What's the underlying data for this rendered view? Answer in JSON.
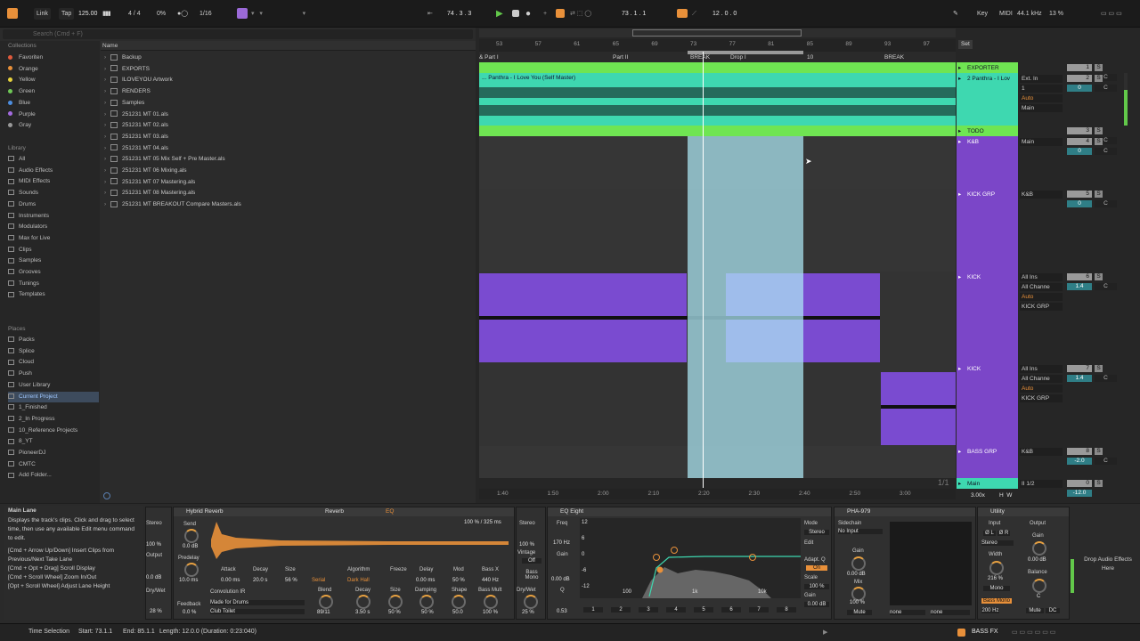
{
  "transport": {
    "link": "Link",
    "tap": "Tap",
    "tempo": "125.00",
    "meter": "4 / 4",
    "percent": "0%",
    "quantize": "1/16",
    "position": "74 . 3 . 3",
    "loop_start": "73 . 1 . 1",
    "loop_length": "12 . 0 . 0",
    "key": "Key",
    "midi": "MIDI",
    "sample_rate": "44.1 kHz",
    "cpu": "13 %"
  },
  "browser": {
    "search_placeholder": "Search (Cmd + F)",
    "collections_heading": "Collections",
    "collections": [
      {
        "label": "Favoriten",
        "color": "#e05a3c"
      },
      {
        "label": "Orange",
        "color": "#e8903a"
      },
      {
        "label": "Yellow",
        "color": "#e7d23d"
      },
      {
        "label": "Green",
        "color": "#6fc857"
      },
      {
        "label": "Blue",
        "color": "#4d8ee0"
      },
      {
        "label": "Purple",
        "color": "#a46be0"
      },
      {
        "label": "Gray",
        "color": "#999999"
      }
    ],
    "library_heading": "Library",
    "library": [
      "All",
      "Audio Effects",
      "MIDI Effects",
      "Sounds",
      "Drums",
      "Instruments",
      "Modulators",
      "Max for Live",
      "Clips",
      "Samples",
      "Grooves",
      "Tunings",
      "Templates"
    ],
    "places_heading": "Places",
    "places": [
      "Packs",
      "Splice",
      "Cloud",
      "Push",
      "User Library",
      "Current Project",
      "1_Finished",
      "2_In Progress",
      "10_Reference Projects",
      "8_YT",
      "PioneerDJ",
      "CMTC",
      "Add Folder..."
    ],
    "name_header": "Name",
    "files": [
      "Backup",
      "EXPORTS",
      "ILOVEYOU Artwork",
      "RENDERS",
      "Samples",
      "251231 MT 01.als",
      "251231 MT 02.als",
      "251231 MT 03.als",
      "251231 MT 04.als",
      "251231 MT 05 Mix Self + Pre Master.als",
      "251231 MT 06 Mixing.als",
      "251231 MT 07 Mastering.als",
      "251231 MT 08 Mastering.als",
      "251231 MT BREAKOUT Compare Masters.als"
    ]
  },
  "arrangement": {
    "bars": [
      "53",
      "57",
      "61",
      "65",
      "69",
      "73",
      "77",
      "81",
      "85",
      "89",
      "93",
      "97"
    ],
    "set_label": "Set",
    "locators": [
      "& Part I",
      "Part II",
      "BREAK",
      "Drop I",
      "10",
      "BREAK"
    ],
    "audio_clip": "... Panthra - I Love You (Self Master)",
    "times": [
      "1:40",
      "1:50",
      "2:00",
      "2:10",
      "2:20",
      "2:30",
      "2:40",
      "2:50",
      "3:00"
    ],
    "page": "1/1"
  },
  "tracks": [
    {
      "name": "EXPORTER",
      "color": "#6fe552",
      "input": "",
      "number": "1",
      "vol": "-∞",
      "pan": "C"
    },
    {
      "name": "2 Panthra - I Lov",
      "color": "#3ed8b0",
      "input": "Ext. In",
      "chan": "1",
      "monitor": "Auto",
      "out": "Main",
      "number": "2",
      "vol": "0",
      "pan": "C"
    },
    {
      "name": "TODO",
      "color": "#6fe552",
      "input": "",
      "number": "3",
      "vol": "-∞",
      "pan": "C"
    },
    {
      "name": "K&B",
      "color": "#7b46c8",
      "input": "Main",
      "number": "4",
      "vol": "0",
      "pan": "C"
    },
    {
      "name": "KICK GRP",
      "color": "#7b46c8",
      "input": "K&B",
      "number": "5",
      "vol": "0",
      "pan": "C"
    },
    {
      "name": "KICK",
      "color": "#7b46c8",
      "input": "All Ins",
      "chan": "All Channe",
      "monitor": "Auto",
      "out": "KICK GRP",
      "number": "6",
      "vol": "1.4",
      "pan": "C"
    },
    {
      "name": "KICK",
      "color": "#7b46c8",
      "input": "All Ins",
      "chan": "All Channe",
      "monitor": "Auto",
      "out": "KICK GRP",
      "number": "7",
      "vol": "1.4",
      "pan": "C"
    },
    {
      "name": "BASS GRP",
      "color": "#7b46c8",
      "input": "K&B",
      "number": "8",
      "vol": "-2.0",
      "pan": "C"
    },
    {
      "name": "Main",
      "color": "#3ed8b0",
      "input": "II 1/2",
      "number": "0",
      "vol": "-12.0",
      "pan": ""
    }
  ],
  "info_view": {
    "title": "Main Lane",
    "body": "Displays the track's clips. Click and drag to select time, then use any available Edit menu command to edit.",
    "shortcuts": [
      "[Cmd + Arrow Up/Down] Insert Clips from Previous/Next Take Lane",
      "[Cmd + Opt + Drag] Scroll Display",
      "[Cmd + Scroll Wheel] Zoom In/Out",
      "[Opt + Scroll Wheel] Adjust Lane Height"
    ]
  },
  "devices": {
    "reverb": {
      "title": "Hybrid Reverb",
      "tab1": "Reverb",
      "tab2": "EQ",
      "send": "Send",
      "send_val": "0.0 dB",
      "predelay": "Predelay",
      "predelay_val": "10.0 ms",
      "feedback": "Feedback",
      "feedback_val": "0.0 %",
      "ir_pct": "100 % / 325 ms",
      "attack": "Attack",
      "attack_val": "0.00 ms",
      "decay": "Decay",
      "decay_val": "20.0 s",
      "size": "Size",
      "size_val": "56 %",
      "serial": "Serial",
      "algorithm": "Algorithm",
      "algorithm_val": "Dark Hall",
      "freeze": "Freeze",
      "delay": "Delay",
      "delay_val": "0.00 ms",
      "mod": "Mod",
      "mod_val": "50 %",
      "bassx": "Bass X",
      "bassx_val": "440 Hz",
      "conv_ir": "Convolution IR",
      "ir1": "Made for Drums",
      "ir2": "Club Toilet",
      "blend": "Blend",
      "blend_val": "89/11",
      "decay2": "Decay",
      "decay2_val": "3.50 s",
      "size2": "Size",
      "size2_val": "50 %",
      "damping": "Damping",
      "damping_val": "50 %",
      "shape": "Shape",
      "shape_val": "50.0",
      "bassmult": "Bass Mult",
      "bassmult_val": "100 %",
      "stereo": "Stereo",
      "stereo_val": "100 %",
      "vintage": "Vintage",
      "vintage_val": "Off",
      "bassmono": "Bass Mono",
      "drywet": "Dry/Wet",
      "drywet_val": "25 %",
      "left_stereo": "Stereo",
      "left_stereo_val": "100 %",
      "output": "Output",
      "output_val": "0.0 dB",
      "left_dw": "Dry/Wet",
      "left_dw_val": "28 %"
    },
    "eq": {
      "title": "EQ Eight",
      "freq": "Freq",
      "freq_val": "170 Hz",
      "gain": "Gain",
      "gain_val": "0.00 dB",
      "q": "Q",
      "q_val": "0.53",
      "mode": "Mode",
      "mode_val": "Stereo",
      "edit": "Edit",
      "scale": "Scale",
      "scale_val": "100 %",
      "adapt": "Adapt. Q",
      "adapt_val": "On",
      "out_gain": "Gain",
      "out_gain_val": "0.00 dB",
      "db_marks": [
        "12",
        "6",
        "0",
        "-6",
        "-12"
      ],
      "freq_marks": [
        "100",
        "1k",
        "10k"
      ],
      "bands": [
        "1",
        "2",
        "3",
        "4",
        "5",
        "6",
        "7",
        "8"
      ]
    },
    "pha": {
      "title": "PHA-979",
      "sidechain": "Sidechain",
      "no_input": "No Input",
      "gain": "Gain",
      "gain_val": "0.00 dB",
      "mix": "Mix",
      "mix_val": "100 %",
      "mute": "Mute",
      "none1": "none",
      "none2": "none"
    },
    "utility": {
      "title": "Utility",
      "input": "Input",
      "output": "Output",
      "phase_l": "Ø L",
      "phase_r": "Ø R",
      "stereo": "Stereo",
      "width": "Width",
      "width_val": "216 %",
      "mono": "Mono",
      "bassmono": "Bass Mono",
      "bassmono_freq": "200 Hz",
      "gain": "Gain",
      "gain_val": "0.00 dB",
      "balance": "Balance",
      "balance_val": "C",
      "mute": "Mute",
      "dc": "DC"
    },
    "drop_hint": "Drop Audio Effects Here"
  },
  "status": {
    "selection": "Time Selection",
    "start": "Start: 73.1.1",
    "end": "End: 85.1.1",
    "length": "Length: 12.0.0 (Duration: 0:23:040)",
    "track": "BASS FX"
  }
}
